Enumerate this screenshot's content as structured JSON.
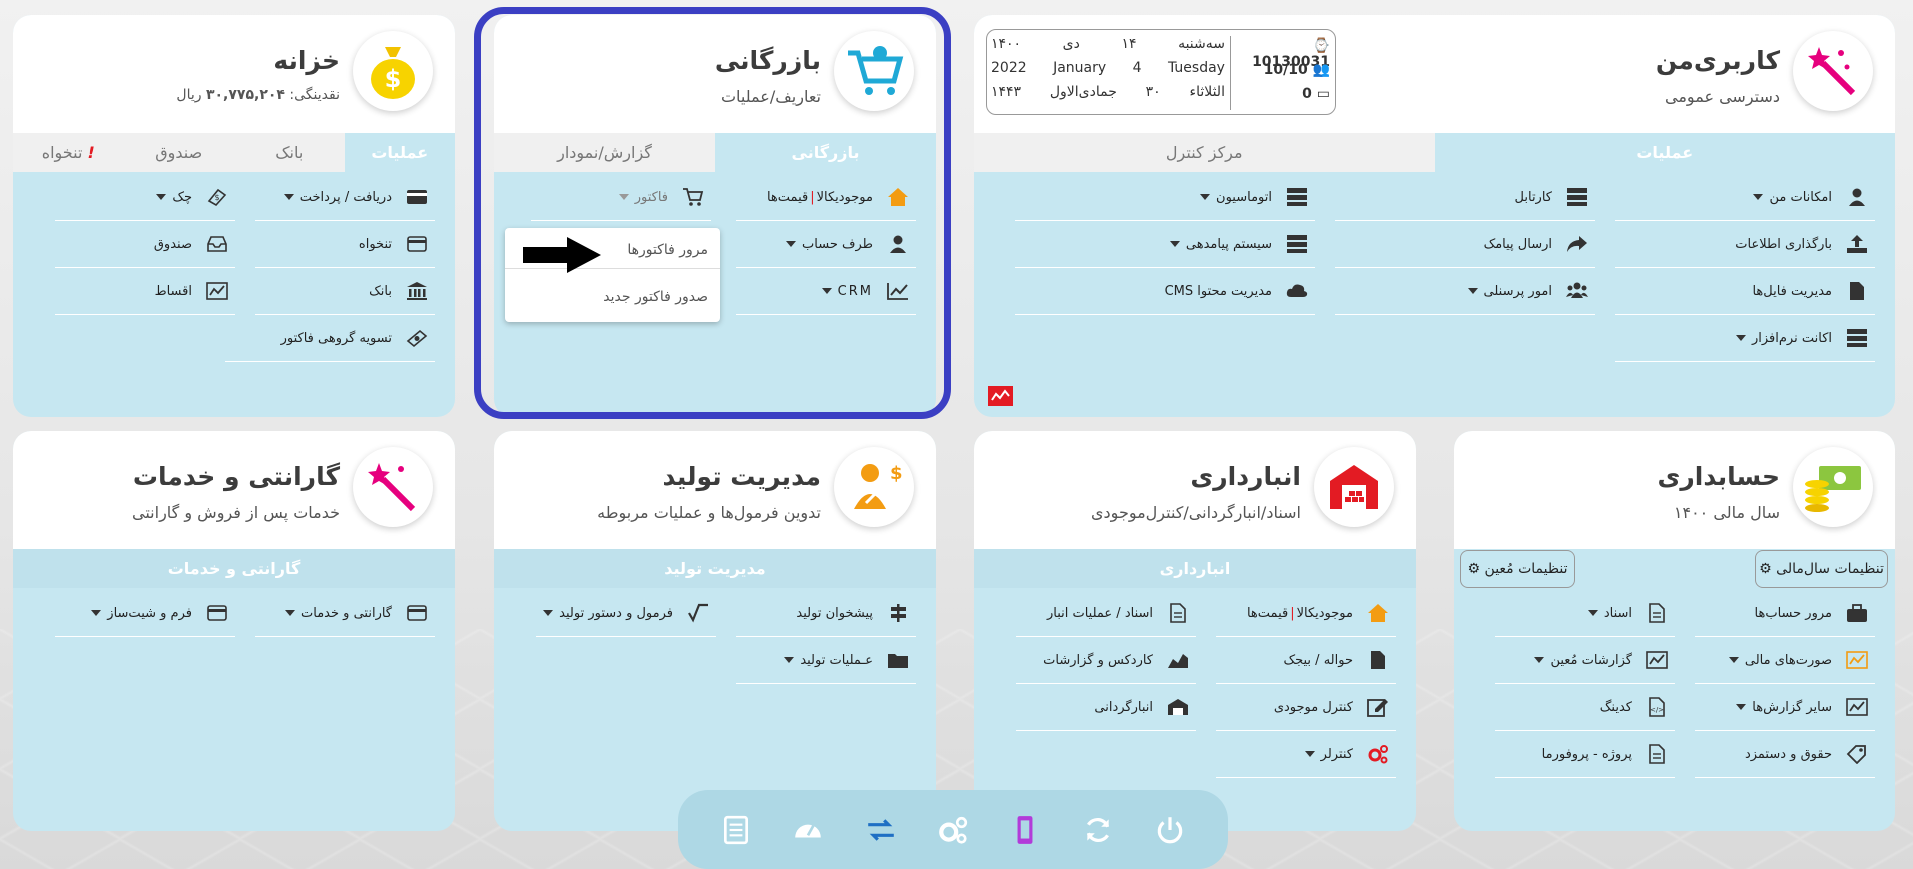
{
  "colors": {
    "card_bg": "#c6e7f1",
    "highlight": "#3b3fc3",
    "dock_bg": "#aed8e5",
    "accent_orange": "#f39c12",
    "accent_red": "#e31b23"
  },
  "khazaneh": {
    "title": "خزانه",
    "sub_label": "نقدینگی:",
    "sub_value": "۳۰,۷۷۵,۲۰۴",
    "sub_unit": "ریال",
    "tabs": [
      "عملیات",
      "بانک",
      "صندوق",
      "تنخواه"
    ],
    "alert": "!",
    "items": [
      "دریافت / پرداخت",
      "چک",
      "تنخواه",
      "صندوق",
      "بانک",
      "اقساط",
      "تسویه گروهی فاکتور"
    ]
  },
  "bazargani": {
    "title": "بازرگانی",
    "sub": "تعاریف/عملیات",
    "tabs": [
      "بازرگانی",
      "گزارش/نمودار"
    ],
    "items": [
      "موجودیکالا",
      "قیمت‌ها",
      "فاکتور",
      "طرف حساب",
      "CRM"
    ],
    "popup": [
      "مرور فاکتورها",
      "صدور فاکتور جدید"
    ]
  },
  "karbari": {
    "title": "کاربری‌من",
    "sub": "دسترسی عمومی",
    "tabs": [
      "عملیات",
      "مرکز کنترل"
    ],
    "items": [
      "امکانات من",
      "کارتابل",
      "اتوماسیون",
      "بارگذاری اطلاعات",
      "ارسال پیامک",
      "سیستم پیامدهی",
      "مدیریت فایل‌ها",
      "امور پرسنلی",
      "CMS مدیریت محتوا",
      "اکانت نرم‌افزار"
    ],
    "info": {
      "id": "10130031",
      "users": "10/10",
      "count": "0",
      "date_fa": [
        "سه‌شنبه",
        "۱۴",
        "دی",
        "۱۴۰۰"
      ],
      "date_en": [
        "Tuesday",
        "4",
        "January",
        "2022"
      ],
      "date_ar": [
        "الثلاثاء",
        "۳۰",
        "جمادی‌الاول",
        "۱۴۴۳"
      ]
    }
  },
  "garanti": {
    "title": "گارانتی و خدمات",
    "sub": "خدمات پس از فروش و گارانتی",
    "bar": "گارانتی و خدمات",
    "items": [
      "گارانتی و خدمات",
      "فرم و شیت‌ساز"
    ]
  },
  "tolid": {
    "title": "مدیریت تولید",
    "sub": "تدوین فرمول‌ها و عملیات مربوطه",
    "bar": "مدیریت تولید",
    "items": [
      "پیشخوان تولید",
      "فرمول و دستور تولید",
      "عـملیات تولید"
    ]
  },
  "anbar": {
    "title": "انبارداری",
    "sub": "اسناد/انبارگردانی/کنترل‌موجودی",
    "bar": "انبارداری",
    "items": [
      "موجودیکالا",
      "قیمت‌ها",
      "اسناد / عملیات انبار",
      "حواله / بیجک",
      "کاردکس و گزارشات",
      "کنترل موجودی",
      "انبارگردانی",
      "کنترلر"
    ]
  },
  "hesab": {
    "title": "حسابداری",
    "sub": "سال مالی ۱۴۰۰",
    "buttons": [
      "تنظیمات سال‌مالی",
      "تنظیمات مُعین"
    ],
    "items": [
      "مرور حساب‌ها",
      "اسناد",
      "صورت‌های مالی",
      "گزارشات مُعین",
      "سایر گزارش‌ها",
      "کدینگ",
      "حقوق و دستمزد",
      "پروژه - پروفورما"
    ]
  },
  "dock": [
    "notes-icon",
    "dashboard-icon",
    "transfer-icon",
    "settings-icon",
    "phone-icon",
    "refresh-icon",
    "power-icon"
  ]
}
